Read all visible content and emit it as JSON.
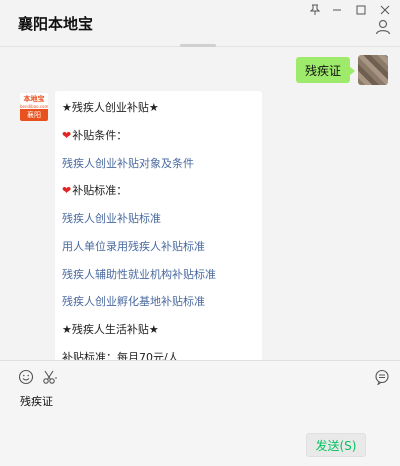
{
  "window": {
    "title": "襄阳本地宝",
    "pin_glyph": "⊥",
    "minimize_glyph": "—",
    "maximize_glyph": "□",
    "close_glyph": "✕"
  },
  "chat": {
    "outgoing_message": "残疾证",
    "reply_lines": [
      {
        "text": "★残疾人创业补贴★",
        "type": "text"
      },
      {
        "text": "补贴条件：",
        "type": "heading"
      },
      {
        "text": "残疾人创业补贴对象及条件",
        "type": "link"
      },
      {
        "text": "补贴标准：",
        "type": "heading"
      },
      {
        "text": "残疾人创业补贴标准",
        "type": "link"
      },
      {
        "text": "用人单位录用残疾人补贴标准",
        "type": "link"
      },
      {
        "text": "残疾人辅助性就业机构补贴标准",
        "type": "link"
      },
      {
        "text": "残疾人创业孵化基地补贴标准",
        "type": "link"
      },
      {
        "text": "★残疾人生活补贴★",
        "type": "text"
      },
      {
        "text": "补贴标准：每月70元/人",
        "type": "text"
      }
    ],
    "oa_logo": {
      "top": "本地宝",
      "mid": "bendibao.com",
      "bottom": "襄阳"
    }
  },
  "input": {
    "text": "残疾证",
    "send_label": "发送(S)"
  },
  "colors": {
    "outgoing_bubble": "#9eea6a",
    "link": "#4a6aa0",
    "send_text": "#07c160",
    "brand_orange": "#e8501e"
  },
  "icons": [
    "pin-icon",
    "minimize-icon",
    "maximize-icon",
    "close-icon",
    "contact-info-icon",
    "emoji-icon",
    "scissors-icon",
    "chat-history-icon",
    "heart-icon"
  ]
}
